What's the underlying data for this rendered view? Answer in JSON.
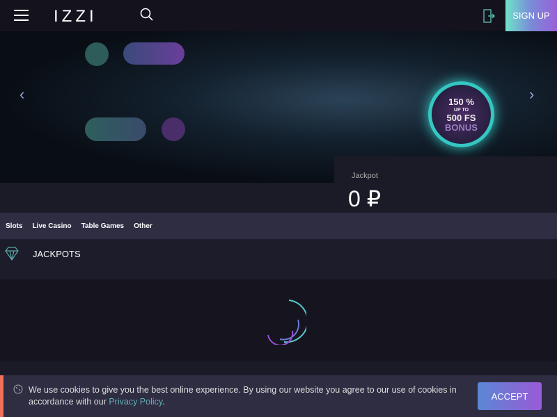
{
  "header": {
    "logo": "IZZI",
    "signup": "SIGN UP"
  },
  "banner": {
    "line1": "150 %",
    "line2": "UP TO",
    "line3": "500 FS",
    "line4": "BONUS"
  },
  "jackpot": {
    "label": "Jackpot",
    "value": "0 ₽"
  },
  "categories": [
    "Slots",
    "Live Casino",
    "Table Games",
    "Other"
  ],
  "section": {
    "title": "JACKPOTS"
  },
  "cookie": {
    "text": "We use cookies to give you the best online experience. By using our website you agree to our use of cookies in accordance with our ",
    "link": "Privacy Policy",
    "end": ".",
    "accept": "ACCEPT"
  },
  "colors": {
    "accent": "#6fe3c9",
    "purple": "#9a60d8",
    "cookie_border": "#f0705a"
  }
}
